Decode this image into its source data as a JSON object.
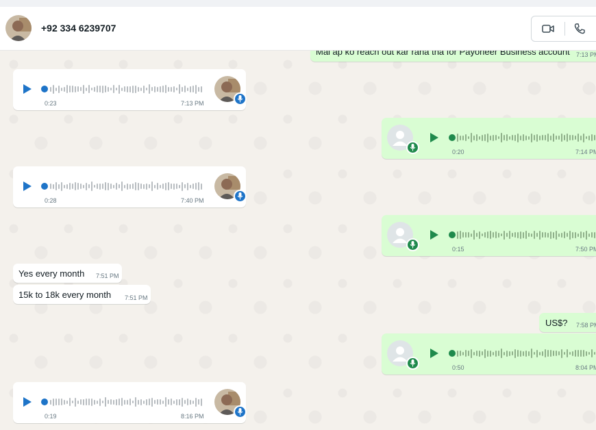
{
  "header": {
    "contact_name": "+92 334 6239707"
  },
  "messages": {
    "m0": {
      "text": "Mai ap ko reach out kar raha tha for Payoneer Business account",
      "time": "7:13 PM"
    },
    "m1": {
      "duration": "0:23",
      "time": "7:13 PM"
    },
    "m2": {
      "duration": "0:20",
      "time": "7:14 PM"
    },
    "m3": {
      "duration": "0:28",
      "time": "7:40 PM"
    },
    "m4": {
      "duration": "0:15",
      "time": "7:50 PM"
    },
    "m5": {
      "text": "Yes every month",
      "time": "7:51 PM"
    },
    "m6": {
      "text": "15k to 18k every month",
      "time": "7:51 PM"
    },
    "m7": {
      "text": "US$?",
      "time": "7:58 PM"
    },
    "m8": {
      "duration": "0:50",
      "time": "8:04 PM"
    },
    "m9": {
      "duration": "0:19",
      "time": "8:16 PM"
    }
  },
  "colors": {
    "incoming_bubble": "#ffffff",
    "outgoing_bubble": "#d9fdd3",
    "incoming_accent": "#1e74c8",
    "outgoing_accent": "#1f8a4c",
    "chat_background": "#f4f1ec"
  },
  "icons": [
    "video-call-icon",
    "voice-call-icon",
    "play-icon",
    "mic-icon",
    "default-avatar-icon"
  ]
}
